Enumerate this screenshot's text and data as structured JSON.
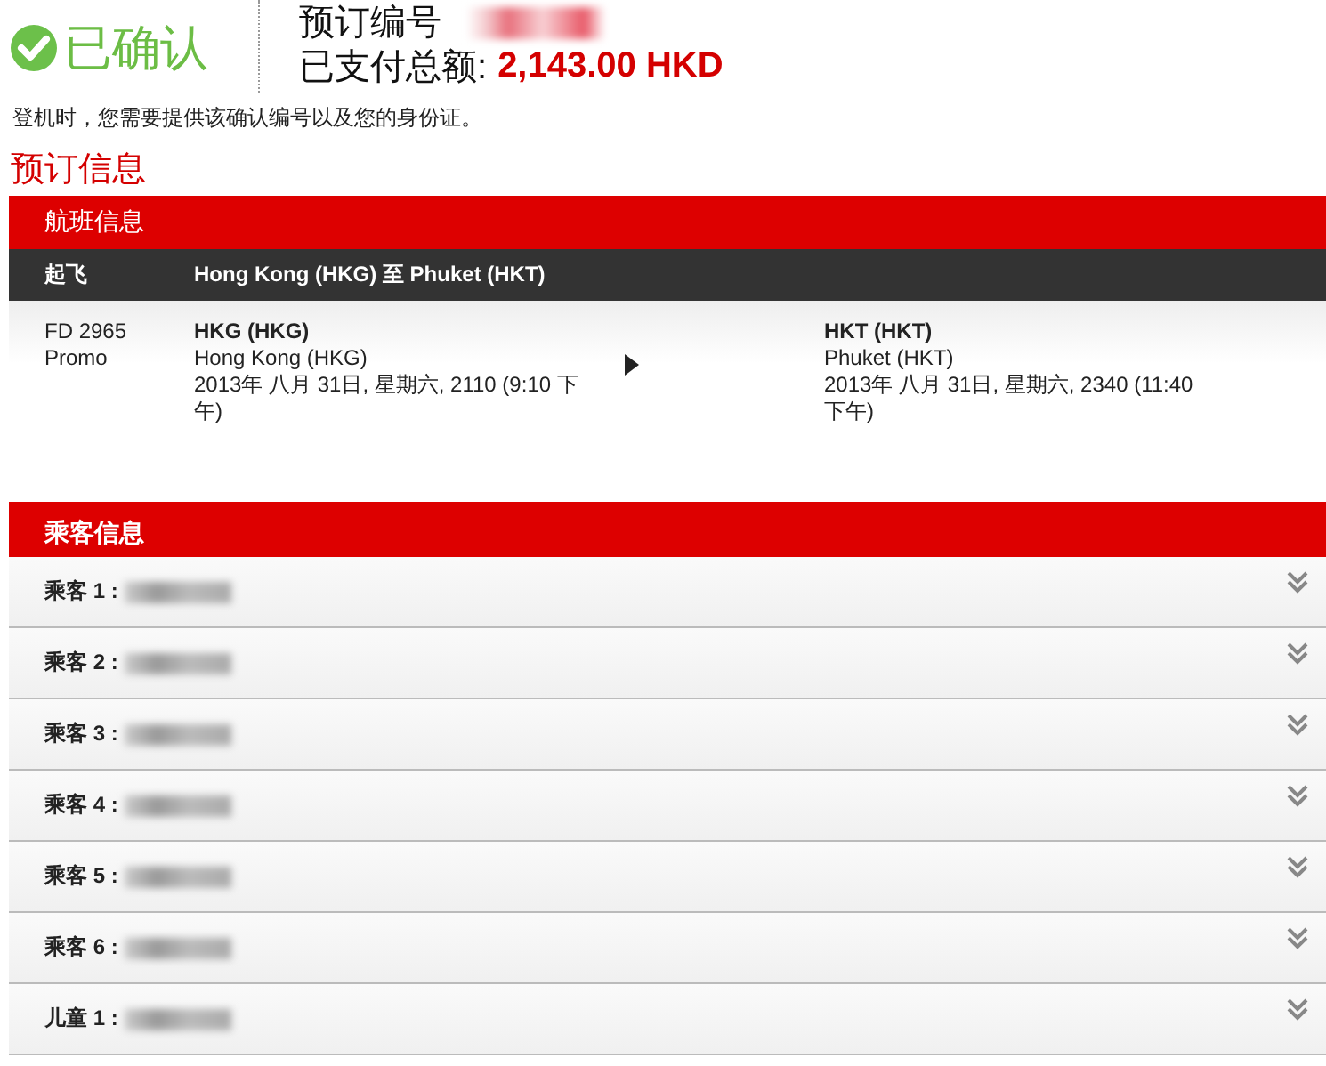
{
  "status": {
    "label": "已确认"
  },
  "booking": {
    "number_label": "预订编号",
    "paid_label": "已支付总额:",
    "paid_amount": "2,143.00 HKD"
  },
  "notice": "登机时，您需要提供该确认编号以及您的身份证。",
  "section_title": "预订信息",
  "flight": {
    "header": "航班信息",
    "leg_label": "起飞",
    "route": "Hong Kong (HKG) 至 Phuket (HKT)",
    "number": "FD 2965",
    "fare": "Promo",
    "departure": {
      "code": "HKG (HKG)",
      "city": "Hong Kong (HKG)",
      "time": "2013年 八月 31日, 星期六, 2110 (9:10 下午)"
    },
    "arrival": {
      "code": "HKT (HKT)",
      "city": "Phuket (HKT)",
      "time": "2013年 八月 31日, 星期六, 2340 (11:40 下午)"
    }
  },
  "passengers": {
    "header": "乘客信息",
    "rows": [
      {
        "label": "乘客 1 :",
        "expanded": false
      },
      {
        "label": "乘客 2 :",
        "expanded": false
      },
      {
        "label": "乘客 3 :",
        "expanded": false
      },
      {
        "label": "乘客 4 :",
        "expanded": false
      },
      {
        "label": "乘客 5 :",
        "expanded": false
      },
      {
        "label": "乘客 6 :",
        "expanded": false
      },
      {
        "label": "儿童 1 :",
        "expanded": false
      }
    ]
  }
}
